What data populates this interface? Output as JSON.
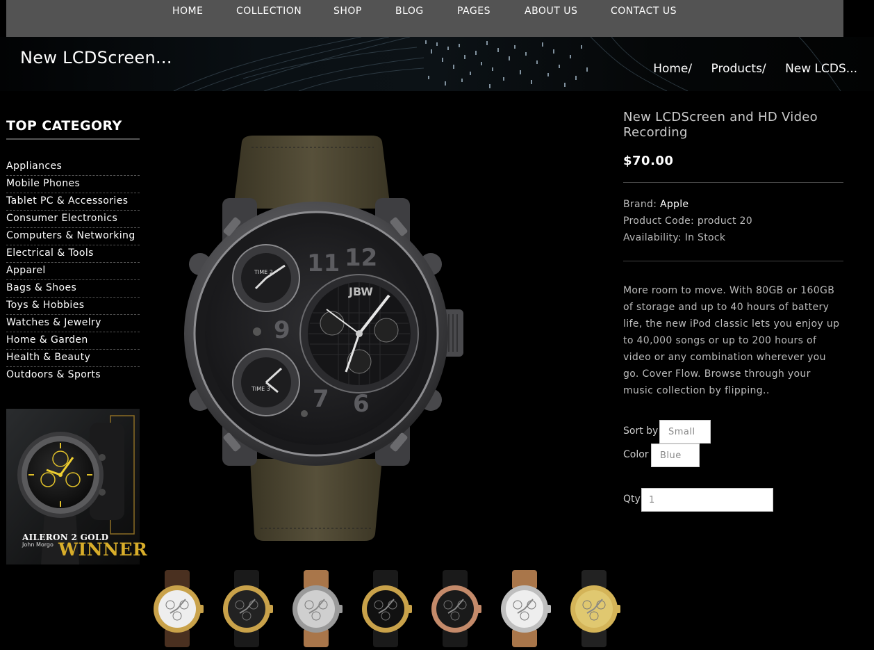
{
  "nav": {
    "items": [
      "HOME",
      "COLLECTION",
      "SHOP",
      "BLOG",
      "PAGES",
      "ABOUT US",
      "CONTACT US"
    ]
  },
  "banner": {
    "title": "New LCDScreen...",
    "breadcrumb": [
      "Home/",
      "Products/",
      "New LCDS..."
    ]
  },
  "sidebar": {
    "title": "TOP CATEGORY",
    "categories": [
      "Appliances",
      "Mobile Phones",
      "Tablet PC & Accessories",
      "Consumer Electronics",
      "Computers & Networking",
      "Electrical & Tools",
      "Apparel",
      "Bags & Shoes",
      "Toys & Hobbies",
      "Watches & Jewelry",
      "Home & Garden",
      "Health & Beauty",
      "Outdoors & Sports"
    ],
    "promo": {
      "title": "AILERON 2 GOLD",
      "author": "John Morgo",
      "badge": "WINNER"
    }
  },
  "product": {
    "name": "New LCDScreen and HD Video Recording",
    "price": "$70.00",
    "brand_label": "Brand:",
    "brand": "Apple",
    "code_label": "Product Code:",
    "code": "product 20",
    "availability_label": "Availability:",
    "availability": "In Stock",
    "description": "More room to move. With 80GB or 160GB of storage and up to 40 hours of battery life, the new iPod classic lets you enjoy up to 40,000 songs or up to 200 hours of video or any combination wherever you go. Cover Flow. Browse through your music collection by flipping..",
    "sort_label": "Sort by",
    "sort_value": "Small",
    "color_label": "Color",
    "color_value": "Blue",
    "qty_label": "Qty",
    "qty_value": "1"
  },
  "main_watch": {
    "dial_numbers": [
      "11",
      "12",
      "9",
      "7",
      "6"
    ],
    "logo": "JBW",
    "subdial_labels": [
      "TIME 2",
      "TIME 3"
    ]
  },
  "thumbnails": [
    {
      "case": "#c9a24a",
      "dial": "#eeeeee",
      "strap": "#4a3020"
    },
    {
      "case": "#c9a24a",
      "dial": "#222222",
      "strap": "#1a1a1a"
    },
    {
      "case": "#9a9a9a",
      "dial": "#cfcfcf",
      "strap": "#a9764a"
    },
    {
      "case": "#c9a24a",
      "dial": "#111111",
      "strap": "#1a1a1a"
    },
    {
      "case": "#c48a6a",
      "dial": "#1a1a1a",
      "strap": "#1a1a1a"
    },
    {
      "case": "#bfbfbf",
      "dial": "#eeeeee",
      "strap": "#a9764a"
    },
    {
      "case": "#d4b458",
      "dial": "#e0c870",
      "strap": "#222222"
    }
  ],
  "colors": {
    "nav_bg": "#535353",
    "page_bg": "#000000",
    "promo_gold": "#d8ad2a"
  }
}
